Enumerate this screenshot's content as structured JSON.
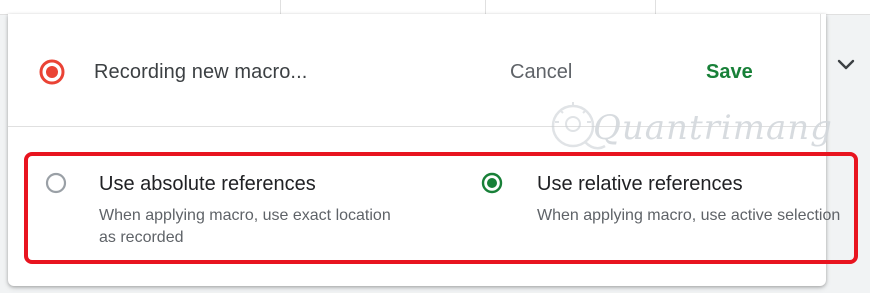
{
  "macro_bar": {
    "status_icon": "record-icon",
    "status_color": "#ea4335",
    "title": "Recording new macro...",
    "cancel_label": "Cancel",
    "save_label": "Save",
    "save_color": "#188038",
    "expand_icon": "chevron-down-icon"
  },
  "reference_options": {
    "absolute": {
      "label": "Use absolute references",
      "description": "When applying macro, use exact location as recorded",
      "selected": false
    },
    "relative": {
      "label": "Use relative references",
      "description": "When applying macro, use active selection",
      "selected": true
    },
    "accent_color": "#188038",
    "highlight_color": "#e8141f"
  },
  "watermark": {
    "text": "Quantrimang"
  }
}
